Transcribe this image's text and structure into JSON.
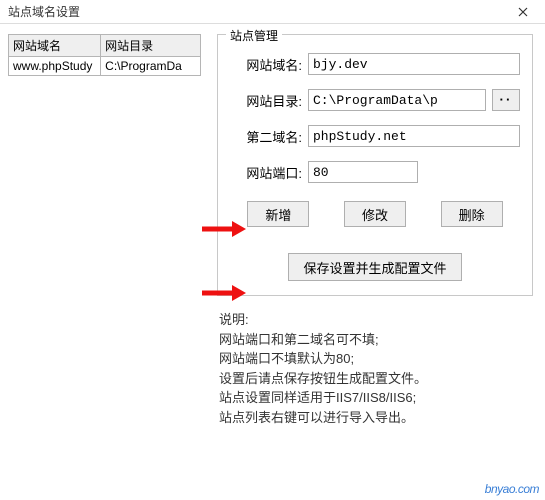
{
  "window": {
    "title": "站点域名设置"
  },
  "table": {
    "headers": [
      "网站域名",
      "网站目录"
    ],
    "rows": [
      {
        "domain": "www.phpStudy",
        "dir": "C:\\ProgramDa"
      }
    ]
  },
  "group": {
    "title": "站点管理",
    "fields": {
      "domain": {
        "label": "网站域名:",
        "value": "bjy.dev"
      },
      "dir": {
        "label": "网站目录:",
        "value": "C:\\ProgramData\\p",
        "browse": "··"
      },
      "second": {
        "label": "第二域名:",
        "value": "phpStudy.net"
      },
      "port": {
        "label": "网站端口:",
        "value": "80"
      }
    },
    "buttons": {
      "add": "新增",
      "edit": "修改",
      "delete": "删除",
      "save": "保存设置并生成配置文件"
    }
  },
  "desc": {
    "title": "说明:",
    "line1": "网站端口和第二域名可不填;",
    "line2": "网站端口不填默认为80;",
    "line3": "设置后请点保存按钮生成配置文件。",
    "line4": "站点设置同样适用于IIS7/IIS8/IIS6;",
    "line5": "站点列表右键可以进行导入导出。"
  },
  "watermark": "bnyao.com"
}
